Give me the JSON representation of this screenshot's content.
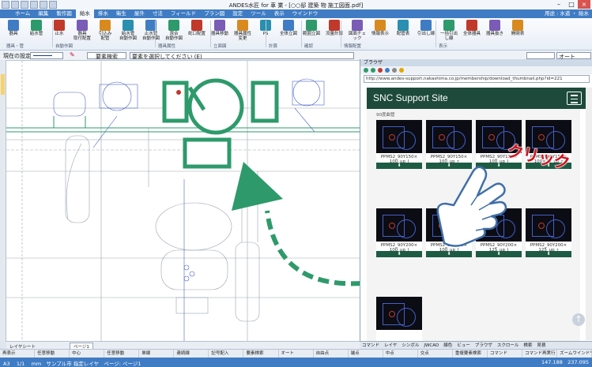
{
  "window": {
    "title": "ANDES水匠 for 車 業 - [○○邸 建築 物 施工図面.pdf]",
    "user": "用途 : 水道 ・ 給水"
  },
  "menu": {
    "tabs": [
      "ホーム",
      "編集",
      "製作図",
      "給水",
      "排水",
      "衛生",
      "屋外",
      "寸法",
      "フィールド",
      "プラン図",
      "設定",
      "ツール",
      "表示",
      "ウインドウ"
    ],
    "active_index": 3
  },
  "ribbon": {
    "buttons": [
      "器具",
      "給水管",
      "止水",
      "器具\n取付配置",
      "引込み\n配管",
      "給水管\n自動作図",
      "止水管\n自動作図",
      "混合\n自動作図",
      "蛇口配置",
      "器具移動",
      "器具属性変更",
      "PS",
      "全体立図",
      "範囲立図",
      "流量計算",
      "図面チェック",
      "情報表示",
      "配管表",
      "引出し線",
      "一括引出し線",
      "全体器具",
      "器具抜き",
      "開閉表"
    ],
    "groups": [
      "器具・管",
      "自動作図",
      "器具属性",
      "立面図",
      "計算",
      "確認",
      "情報配置",
      "表示"
    ]
  },
  "toolbar": {
    "layer_label": "現在の設定",
    "search_label": "要素検索",
    "select_hint": "要素を選択してください (E)",
    "right_value": "オート"
  },
  "browser": {
    "header": "ブラウザ",
    "url": "http://www.andes-support.nakashima.co.jp/membership/download_thumbnail.php?id=221",
    "site_name": "SNC Support Site",
    "crumb": "90度曲管",
    "items": [
      {
        "caption": "PPMS2_90Y150×\n100_up_l"
      },
      {
        "caption": "PPMS2_90Y150×\n100_up_r"
      },
      {
        "caption": "PPMS2_90Y150×\n100_up_l"
      },
      {
        "caption": "PPMS2_90Y150×\n100×75_up_r"
      },
      {
        "caption": "PPMS2_90Y200×\n100_up_l"
      },
      {
        "caption": "PPMS2_90Y200×\n100_up_l"
      },
      {
        "caption": "PPMS2_90Y200×\n125_up_l"
      },
      {
        "caption": "PPMS2_90Y200×\n125_up_r"
      },
      {
        "caption": ""
      }
    ],
    "download_glyph": "⬇"
  },
  "overlay": {
    "click_text": "クリック"
  },
  "panel_tabs": [
    "コマンド",
    "レイヤ",
    "シンボル",
    "JWCAD",
    "線色",
    "ビュー",
    "ブラウザ",
    "スクロール",
    "検索",
    "見積"
  ],
  "layer_tabs": {
    "label": "レイヤシート",
    "page": "ページ1"
  },
  "function_keys": [
    "再表示",
    "任意移動",
    "中心",
    "任意移動",
    "単線",
    "連続線",
    "記号配入",
    "要素検索",
    "オート",
    "自由点",
    "端点",
    "中点",
    "交点",
    "重複要素検索",
    "コマンド",
    "コマンド再実行",
    "ズームウインドウ"
  ],
  "status": {
    "paper": "A3",
    "scale": "1/1",
    "unit": "mm",
    "layer": "サンプル市 指定レイヤ",
    "page_label": "ページ: ページ1",
    "coords": "147.188",
    "coords2": "237.095"
  },
  "colors": {
    "menu_blue": "#3f7cc4",
    "drawing_green": "#2e9a6b",
    "site_green": "#1d4a3a",
    "click_red": "#d0121b"
  }
}
